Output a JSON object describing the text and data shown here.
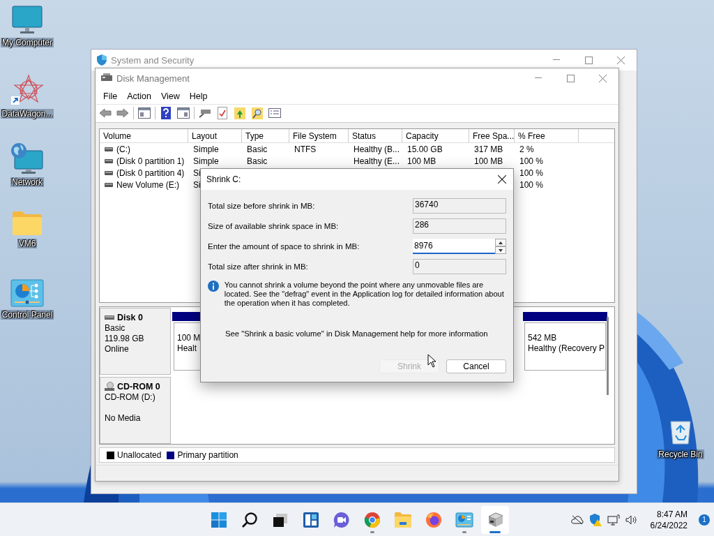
{
  "desktop_icons": [
    {
      "label": "My Computer",
      "kind": "monitor"
    },
    {
      "label": "DataWagon...",
      "kind": "star-shortcut"
    },
    {
      "label": "Network",
      "kind": "network"
    },
    {
      "label": "VM6",
      "kind": "folder"
    },
    {
      "label": "Control Panel",
      "kind": "control-panel"
    }
  ],
  "recycle_bin": {
    "label": "Recycle Bin"
  },
  "back_window": {
    "title": "System and Security"
  },
  "disk_management": {
    "title": "Disk Management",
    "menu": [
      "File",
      "Action",
      "View",
      "Help"
    ],
    "columns": [
      "Volume",
      "Layout",
      "Type",
      "File System",
      "Status",
      "Capacity",
      "Free Spa...",
      "% Free"
    ],
    "rows": [
      {
        "volume": "(C:)",
        "layout": "Simple",
        "type": "Basic",
        "file_system": "NTFS",
        "status": "Healthy (B...",
        "capacity": "15.00 GB",
        "free_space": "317 MB",
        "percent_free": "2 %"
      },
      {
        "volume": "(Disk 0 partition 1)",
        "layout": "Simple",
        "type": "Basic",
        "status": "Healthy (E...",
        "capacity": "100 MB",
        "free_space": "100 MB",
        "percent_free": "100 %"
      },
      {
        "volume": "(Disk 0 partition 4)",
        "layout": "Si",
        "percent_free": "100 %"
      },
      {
        "volume": "New Volume (E:)",
        "layout": "Si",
        "percent_free": "100 %"
      }
    ],
    "disks": [
      {
        "kind": "disk",
        "name": "Disk 0",
        "lines": [
          "Basic",
          "119.98 GB",
          "Online"
        ],
        "partitions": [
          {
            "lines": [
              "100 M",
              "Healt"
            ]
          },
          {
            "lines": [
              "542 MB",
              "Healthy (Recovery P"
            ]
          }
        ]
      },
      {
        "kind": "cdrom",
        "name": "CD-ROM 0",
        "lines": [
          "CD-ROM (D:)",
          "No Media"
        ]
      }
    ],
    "legend": [
      {
        "label": "Unallocated",
        "color": "#000000"
      },
      {
        "label": "Primary partition",
        "color": "#000080"
      }
    ]
  },
  "dialog": {
    "title": "Shrink C:",
    "fields": [
      {
        "label": "Total size before shrink in MB:",
        "value": "36740",
        "editable": false
      },
      {
        "label": "Size of available shrink space in MB:",
        "value": "286",
        "editable": false
      },
      {
        "label": "Enter the amount of space to shrink in MB:",
        "value": "8976",
        "editable": true
      },
      {
        "label": "Total size after shrink in MB:",
        "value": "0",
        "editable": false
      }
    ],
    "info": "You cannot shrink a volume beyond the point where any unmovable files are located. See the \"defrag\" event in the Application log for detailed information about the operation when it has completed.",
    "help": "See \"Shrink a basic volume\" in Disk Management help for more information",
    "buttons": [
      {
        "label": "Shrink",
        "disabled": true
      },
      {
        "label": "Cancel",
        "disabled": false
      }
    ]
  },
  "taskbar": {
    "apps": [
      {
        "kind": "start",
        "running": false,
        "active": false
      },
      {
        "kind": "search",
        "running": false,
        "active": false
      },
      {
        "kind": "taskview",
        "running": false,
        "active": false
      },
      {
        "kind": "widgets",
        "running": false,
        "active": false
      },
      {
        "kind": "chat",
        "running": false,
        "active": false
      },
      {
        "kind": "browser",
        "running": true,
        "active": false
      },
      {
        "kind": "explorer",
        "running": false,
        "active": false
      },
      {
        "kind": "firefox",
        "running": false,
        "active": false
      },
      {
        "kind": "controlpanel",
        "running": true,
        "active": false
      },
      {
        "kind": "diskmgmt",
        "running": true,
        "active": true
      }
    ],
    "time": "8:47 AM",
    "date": "6/24/2022",
    "notifications": "1"
  }
}
